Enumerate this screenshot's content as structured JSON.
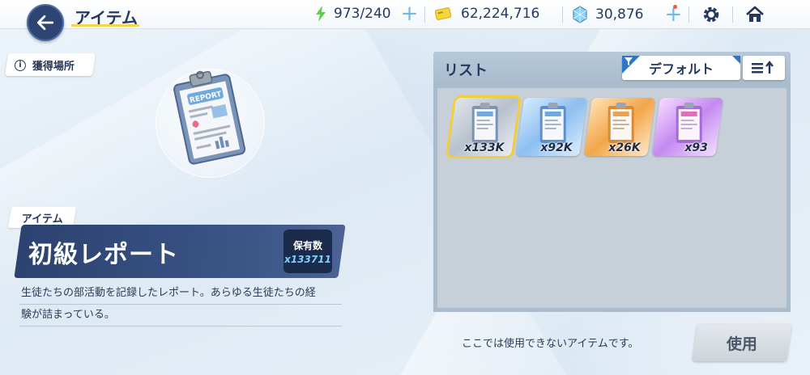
{
  "header": {
    "title": "アイテム",
    "ap": "973/240",
    "credits": "62,224,716",
    "gems": "30,876"
  },
  "left": {
    "acquire_label": "獲得場所",
    "category": "アイテム",
    "item_name": "初級レポート",
    "owned_label": "保有数",
    "owned_value": "x133711",
    "description_line1": "生徒たちの部活動を記録したレポート。あらゆる生徒たちの経",
    "description_line2": "験が詰まっている。"
  },
  "list": {
    "title": "リスト",
    "sort_label": "デフォルト",
    "items": [
      {
        "qty": "x133K",
        "tier": "gray"
      },
      {
        "qty": "x92K",
        "tier": "blue"
      },
      {
        "qty": "x26K",
        "tier": "orange"
      },
      {
        "qty": "x93",
        "tier": "purple"
      }
    ]
  },
  "footer": {
    "note": "ここでは使用できないアイテムです。",
    "use_label": "使用"
  },
  "colors": {
    "navy": "#2e4573",
    "accent_yellow": "#f3d64a",
    "plus_blue": "#6fb7e6",
    "owned_value": "#7fd0ff"
  }
}
